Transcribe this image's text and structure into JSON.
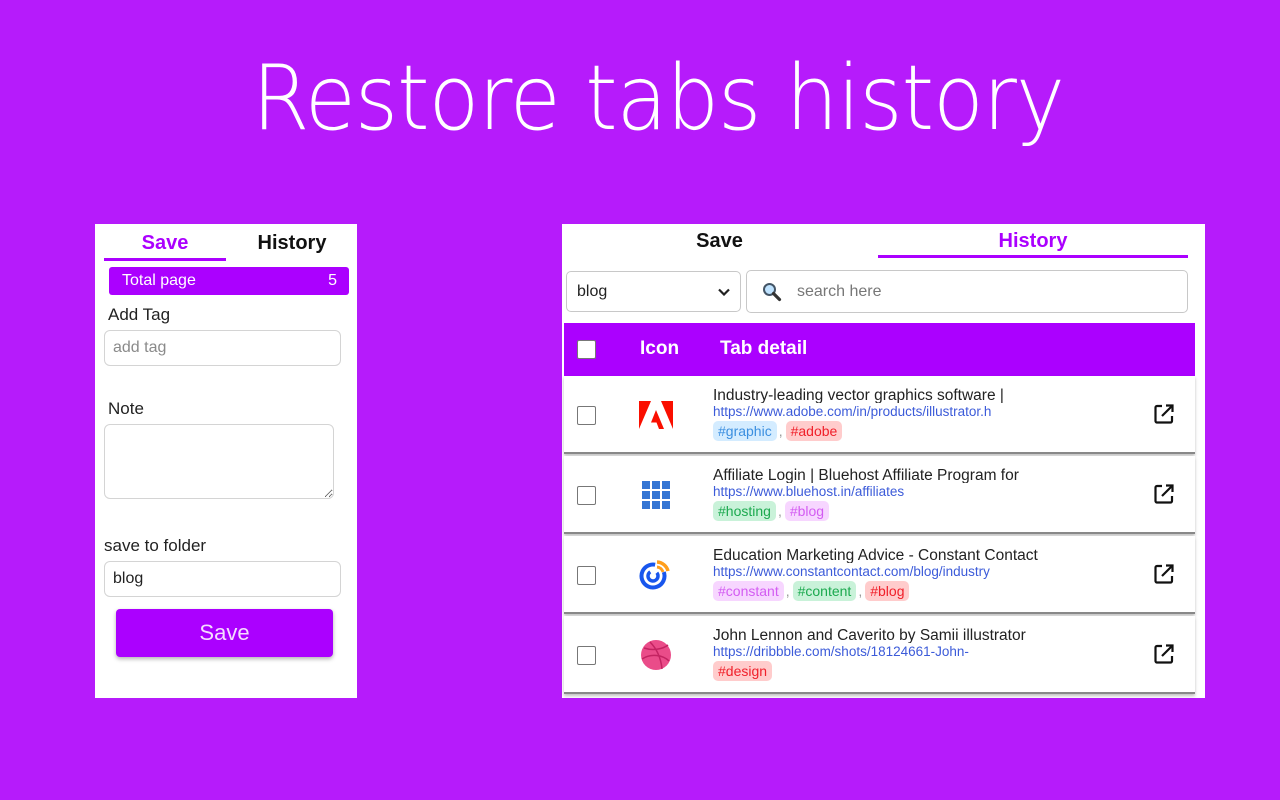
{
  "hero": {
    "title": "Restore tabs history"
  },
  "save_panel": {
    "tabs": [
      {
        "label": "Save",
        "active": true
      },
      {
        "label": "History",
        "active": false
      }
    ],
    "total_page_label": "Total page",
    "total_page_value": "5",
    "add_tag_label": "Add Tag",
    "add_tag_placeholder": "add tag",
    "add_tag_value": "",
    "note_label": "Note",
    "note_value": "",
    "folder_label": "save to folder",
    "folder_value": "blog",
    "save_button": "Save"
  },
  "history_panel": {
    "tabs": [
      {
        "label": "Save",
        "active": false
      },
      {
        "label": "History",
        "active": true
      }
    ],
    "folder_select": {
      "value": "blog",
      "icon": "chevron-down-icon"
    },
    "search": {
      "placeholder": "search here",
      "value": "",
      "icon": "magnifier-icon"
    },
    "table_headers": {
      "icon": "Icon",
      "detail": "Tab detail"
    },
    "rows": [
      {
        "favicon": "adobe-icon",
        "title": "Industry-leading vector graphics software |",
        "url": "https://www.adobe.com/in/products/illustrator.h",
        "tags": [
          {
            "text": "#graphic",
            "bg": "#d4ecff",
            "fg": "#3b8fe0"
          },
          {
            "text": "#adobe",
            "bg": "#ffcccc",
            "fg": "#f0202a"
          }
        ]
      },
      {
        "favicon": "bluehost-icon",
        "title": "Affiliate Login | Bluehost Affiliate Program for",
        "url": "https://www.bluehost.in/affiliates",
        "tags": [
          {
            "text": "#hosting",
            "bg": "#c9f2d9",
            "fg": "#1ca94f"
          },
          {
            "text": "#blog",
            "bg": "#f7d6ff",
            "fg": "#d35cf2"
          }
        ]
      },
      {
        "favicon": "constant-contact-icon",
        "title": "Education Marketing Advice - Constant Contact",
        "url": "https://www.constantcontact.com/blog/industry",
        "tags": [
          {
            "text": "#constant",
            "bg": "#f7d6ff",
            "fg": "#d35cf2"
          },
          {
            "text": "#content",
            "bg": "#c9f2d9",
            "fg": "#1ca94f"
          },
          {
            "text": "#blog",
            "bg": "#ffcccc",
            "fg": "#f0202a"
          }
        ]
      },
      {
        "favicon": "dribbble-icon",
        "title": "John Lennon and Caverito by Samii illustrator",
        "url": "https://dribbble.com/shots/18124661-John-",
        "tags": [
          {
            "text": "#design",
            "bg": "#ffcccc",
            "fg": "#f0202a"
          }
        ]
      }
    ]
  },
  "colors": {
    "background": "#b61bfb",
    "accent": "#ab00ff",
    "link": "#3c5bd9"
  }
}
